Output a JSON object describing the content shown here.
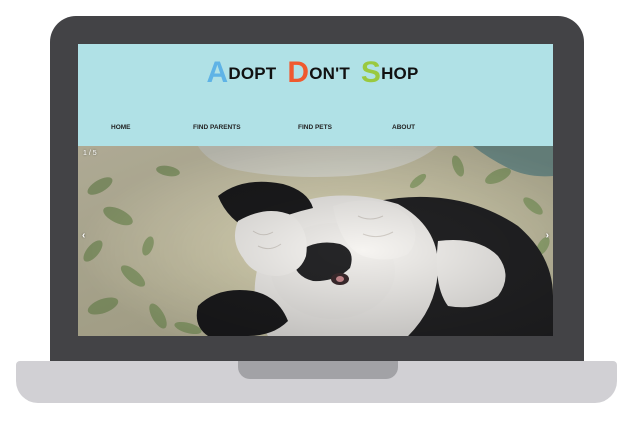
{
  "site": {
    "logo": {
      "parts": [
        {
          "cap": "A",
          "rest": "DOPT"
        },
        {
          "cap": "D",
          "rest": "ON'T"
        },
        {
          "cap": "S",
          "rest": "HOP"
        }
      ]
    },
    "nav": {
      "items": [
        "HOME",
        "FIND PARENTS",
        "FIND PETS",
        "ABOUT"
      ]
    },
    "carousel": {
      "counter": "1 / 5",
      "prev_icon": "‹",
      "next_icon": "›",
      "image": "sleeping-kitten-photo"
    }
  },
  "colors": {
    "header_bg": "#b0e1e6",
    "laptop_body": "#434346",
    "laptop_base": "#d1d0d4",
    "logo_a": "#5fb3e6",
    "logo_d": "#ef5a2f",
    "logo_s": "#9ac93f"
  }
}
